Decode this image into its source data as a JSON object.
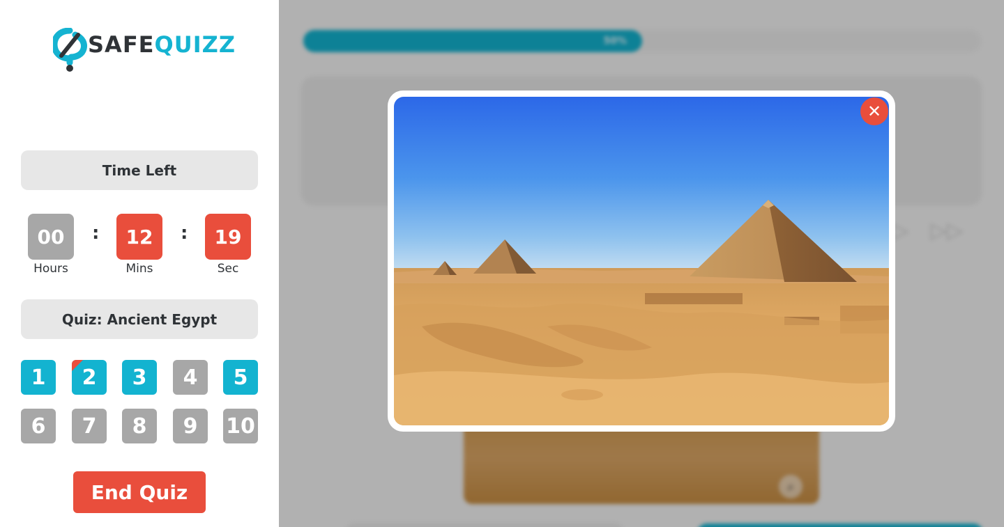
{
  "brand": {
    "part1": "SAFE",
    "part2": "QUIZZ",
    "colors": {
      "dark": "#2f3337",
      "accent": "#15b3d1"
    }
  },
  "timer": {
    "title": "Time Left",
    "hours": "00",
    "hours_label": "Hours",
    "mins": "12",
    "mins_label": "Mins",
    "sec": "19",
    "sec_label": "Sec",
    "separator": ":"
  },
  "quiz": {
    "title": "Quiz: Ancient Egypt"
  },
  "questions": [
    {
      "num": "1",
      "status": "answered"
    },
    {
      "num": "2",
      "status": "current"
    },
    {
      "num": "3",
      "status": "answered"
    },
    {
      "num": "4",
      "status": "unanswered"
    },
    {
      "num": "5",
      "status": "answered"
    },
    {
      "num": "6",
      "status": "unanswered"
    },
    {
      "num": "7",
      "status": "unanswered"
    },
    {
      "num": "8",
      "status": "unanswered"
    },
    {
      "num": "9",
      "status": "unanswered"
    },
    {
      "num": "10",
      "status": "unanswered"
    }
  ],
  "end_button": "End Quiz",
  "progress": {
    "label": "50%",
    "value": 0.5
  },
  "colors": {
    "answered": "#13b3d0",
    "unanswered": "#a7a7a7",
    "danger": "#e94e3c"
  },
  "modal": {
    "close_icon": "close-icon",
    "image": "pyramids-of-giza-photo"
  }
}
